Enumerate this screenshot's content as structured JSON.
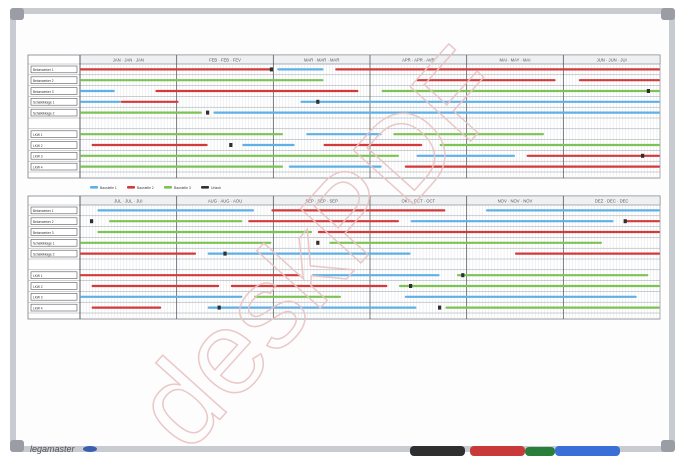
{
  "board": {
    "brand": "legamaster",
    "frame_color": "#c8ccd1",
    "surface_color": "#fdfdfd",
    "grid_color": "#d6d9de",
    "header_fill": "#eef0f2"
  },
  "planner_top": {
    "month_headers": [
      "JAN · JAN · JAN",
      "FEB · FEB · FEV",
      "MAR · MAR · MAR",
      "APR · APR · AVR",
      "MAI · MAY · MAI",
      "JUN · JUN · JUI"
    ]
  },
  "planner_bottom": {
    "month_headers": [
      "JUL · JUL · JUI",
      "AUG · AUG · AOU",
      "SEP · SEP · SEP",
      "OKT · OCT · OCT",
      "NOV · NOV · NOV",
      "DEZ · DEC · DEC"
    ]
  },
  "row_labels": [
    "Betonwerker 1",
    "Betonwerker 2",
    "Betonwerker 3",
    "Schalkikkage 1",
    "Schalkikkage 2",
    "",
    "LKW 1",
    "LKW 2",
    "LKW 3",
    "LKW 4"
  ],
  "legend": [
    {
      "label": "Baustelle 1",
      "color": "#5fb0e6"
    },
    {
      "label": "Baustelle 2",
      "color": "#d43a3a"
    },
    {
      "label": "Baustelle 3",
      "color": "#7dc353"
    },
    {
      "label": "Urlaub",
      "color": "#333333"
    }
  ],
  "marker_colors": [
    "#2f2f2f",
    "#c83a3a",
    "#e0a23a",
    "#2a7e3c",
    "#3a6fd8"
  ],
  "watermark": "deskPDF",
  "tray_markers": [
    "black",
    "red",
    "green",
    "blue"
  ]
}
